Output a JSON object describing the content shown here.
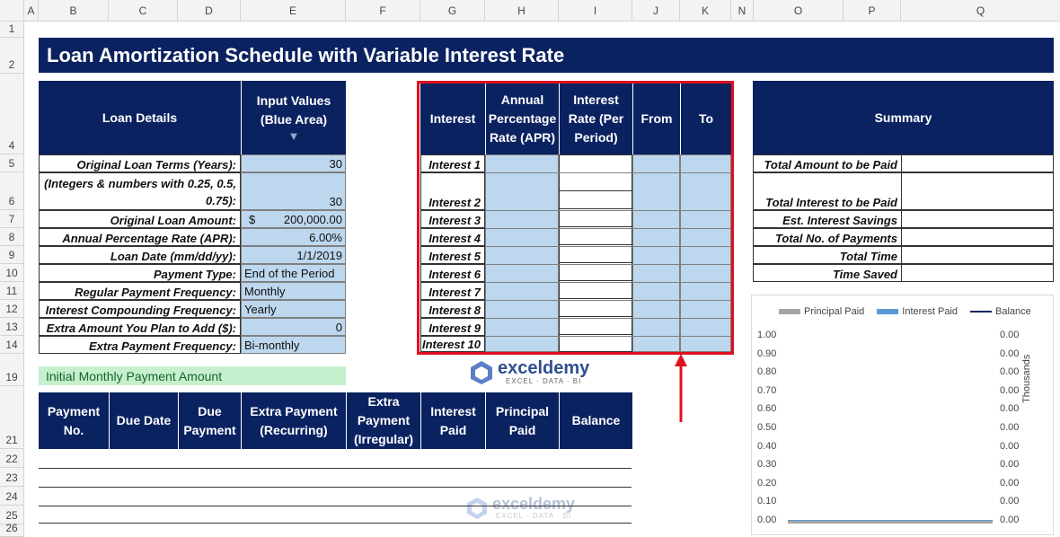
{
  "columns": [
    "A",
    "B",
    "C",
    "D",
    "E",
    "F",
    "G",
    "H",
    "I",
    "J",
    "K",
    "N",
    "O",
    "P",
    "Q"
  ],
  "rows": [
    "1",
    "2",
    "4",
    "5",
    "6",
    "7",
    "8",
    "9",
    "10",
    "11",
    "12",
    "13",
    "14",
    "19",
    "21",
    "22",
    "23",
    "24",
    "25",
    "26"
  ],
  "title": "Loan Amortization Schedule with Variable Interest Rate",
  "loan": {
    "header_details": "Loan Details",
    "header_input": "Input Values (Blue Area)",
    "items": [
      {
        "label": "Original Loan Terms (Years):",
        "value": "30"
      },
      {
        "label": "(Integers & numbers with 0.25, 0.5, 0.75):",
        "value": "30"
      },
      {
        "label": "Original Loan Amount:",
        "currency": "$",
        "value": "200,000.00"
      },
      {
        "label": "Annual Percentage Rate (APR):",
        "value": "6.00%"
      },
      {
        "label": "Loan Date (mm/dd/yy):",
        "value": "1/1/2019"
      },
      {
        "label": "Payment Type:",
        "value": "End of the Period"
      },
      {
        "label": "Regular Payment Frequency:",
        "value": "Monthly"
      },
      {
        "label": "Interest Compounding Frequency:",
        "value": "Yearly"
      },
      {
        "label": "Extra Amount You Plan to Add ($):",
        "value": "0"
      },
      {
        "label": "Extra Payment Frequency:",
        "value": "Bi-monthly"
      }
    ]
  },
  "interest_table": {
    "headers": [
      "Interest",
      "Annual Percentage Rate (APR)",
      "Interest Rate (Per Period)",
      "From",
      "To"
    ],
    "rows": [
      "Interest 1",
      "Interest 2",
      "Interest 3",
      "Interest 4",
      "Interest 5",
      "Interest 6",
      "Interest 7",
      "Interest 8",
      "Interest 9",
      "Interest 10"
    ]
  },
  "summary": {
    "header": "Summary",
    "items": [
      "Total Amount to be Paid",
      "Total Interest to be Paid",
      "Est. Interest Savings",
      "Total No. of Payments",
      "Total Time",
      "Time Saved"
    ]
  },
  "initial_payment_label": "Initial Monthly Payment Amount",
  "schedule": {
    "headers": [
      "Payment No.",
      "Due Date",
      "Due Payment",
      "Extra Payment (Recurring)",
      "Extra Payment (Irregular)",
      "Interest Paid",
      "Principal Paid",
      "Balance"
    ]
  },
  "watermark": {
    "name": "exceldemy",
    "tagline": "EXCEL · DATA · BI"
  },
  "chart_data": {
    "type": "bar",
    "series": [
      {
        "name": "Principal Paid",
        "color": "#a5a5a5",
        "values": []
      },
      {
        "name": "Interest Paid",
        "color": "#5b9bd5",
        "values": []
      },
      {
        "name": "Balance",
        "color": "#0b2261",
        "values": []
      }
    ],
    "left_ticks": [
      "1.00",
      "0.90",
      "0.80",
      "0.70",
      "0.60",
      "0.50",
      "0.40",
      "0.30",
      "0.20",
      "0.10",
      "0.00"
    ],
    "right_ticks": [
      "0.00",
      "0.00",
      "0.00",
      "0.00",
      "0.00",
      "0.00",
      "0.00",
      "0.00",
      "0.00",
      "0.00",
      "0.00"
    ],
    "ylim": [
      0,
      1
    ],
    "right_axis_label": "Thousands",
    "legend_position": "top"
  },
  "colors": {
    "navy": "#0b2261",
    "input_blue": "#bdd7ee",
    "highlight_red": "#e0101f",
    "green_fill": "#c6efce"
  }
}
